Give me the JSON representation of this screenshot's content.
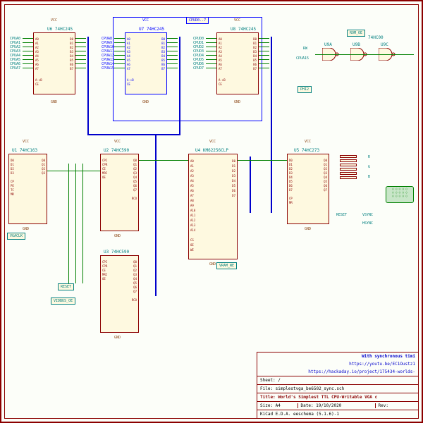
{
  "schematic": {
    "components": {
      "u6": {
        "ref": "U6",
        "part": "74HC245",
        "pins_left": [
          "A0",
          "A1",
          "A2",
          "A3",
          "A4",
          "A5",
          "A6",
          "A7"
        ],
        "pins_right": [
          "B0",
          "B1",
          "B2",
          "B3",
          "B4",
          "B5",
          "B6",
          "B7"
        ],
        "dir": "A->B",
        "ce": "CE",
        "power": "VCC",
        "gnd": "GND"
      },
      "u7": {
        "ref": "U7",
        "part": "74HC245",
        "pins_left": [
          "A0",
          "A1",
          "A2",
          "A3",
          "A4",
          "A5",
          "A6",
          "A7"
        ],
        "pins_right": [
          "B0",
          "B1",
          "B2",
          "B3",
          "B4",
          "B5",
          "B6",
          "B7"
        ],
        "dir": "A->B",
        "ce": "CE",
        "power": "VCC",
        "gnd": "GND"
      },
      "u8": {
        "ref": "U8",
        "part": "74HC245",
        "pins_left": [
          "A0",
          "A1",
          "A2",
          "A3",
          "A4",
          "A5",
          "A6",
          "A7"
        ],
        "pins_right": [
          "B0",
          "B1",
          "B2",
          "B3",
          "B4",
          "B5",
          "B6",
          "B7"
        ],
        "dir": "A->B",
        "ce": "CE",
        "power": "VCC",
        "gnd": "GND"
      },
      "u1": {
        "ref": "U1",
        "part": "74HC163",
        "pins": [
          "CP",
          "PE",
          "TC",
          "MR",
          "Q0",
          "Q1",
          "Q2",
          "Q3",
          "D0",
          "D1",
          "D2",
          "D3"
        ],
        "power": "VCC",
        "gnd": "GND"
      },
      "u2": {
        "ref": "U2",
        "part": "74HC590",
        "pins": [
          "CPC",
          "CPR",
          "CE",
          "MRC",
          "OE",
          "Q0",
          "Q1",
          "Q2",
          "Q3",
          "Q4",
          "Q5",
          "Q6",
          "Q7",
          "RCO"
        ],
        "power": "VCC",
        "gnd": "GND"
      },
      "u3": {
        "ref": "U3",
        "part": "74HC590",
        "pins": [
          "CPC",
          "CPR",
          "CE",
          "MRC",
          "OE",
          "Q0",
          "Q1",
          "Q2",
          "Q3",
          "Q4",
          "Q5",
          "Q6",
          "Q7",
          "RCO"
        ],
        "power": "VCC",
        "gnd": "GND"
      },
      "u4": {
        "ref": "U4",
        "part": "KM62256CLP",
        "pins_addr": [
          "A0",
          "A1",
          "A2",
          "A3",
          "A4",
          "A5",
          "A6",
          "A7",
          "A8",
          "A9",
          "A10",
          "A11",
          "A12",
          "A13",
          "A14"
        ],
        "pins_data": [
          "D0",
          "D1",
          "D2",
          "D3",
          "D4",
          "D5",
          "D6",
          "D7"
        ],
        "ctrl": [
          "CS",
          "OE",
          "WE"
        ],
        "power": "VCC",
        "gnd": "GND"
      },
      "u5": {
        "ref": "U5",
        "part": "74HC273",
        "pins": [
          "D0",
          "D1",
          "D2",
          "D3",
          "D4",
          "D5",
          "D6",
          "D7",
          "Q0",
          "Q1",
          "Q2",
          "Q3",
          "Q4",
          "Q5",
          "Q6",
          "Q7",
          "CP",
          "MR"
        ],
        "power": "VCC",
        "gnd": "GND"
      },
      "u9a": {
        "ref": "U9A",
        "part": "74HC00"
      },
      "u9b": {
        "ref": "U9B",
        "part": "74HC00"
      },
      "u9c": {
        "ref": "U9C",
        "part": "74HC00"
      }
    },
    "nets": {
      "cpud": "CPUD0..7",
      "cpua_left": [
        "CPUA0",
        "CPUA1",
        "CPUA2",
        "CPUA3",
        "CPUA4",
        "CPUA5",
        "CPUA6",
        "CPUA7"
      ],
      "cpua_mid": [
        "CPUA8",
        "CPUA9",
        "CPUA10",
        "CPUA11",
        "CPUA12",
        "CPUA13",
        "CPUA14",
        "CPUA15"
      ],
      "cpud_labels": [
        "CPUD0",
        "CPUD1",
        "CPUD2",
        "CPUD3",
        "CPUD4",
        "CPUD5",
        "CPUD6",
        "CPUD7"
      ],
      "addr_bus": [
        "A0",
        "A1",
        "A2",
        "A3",
        "A4",
        "A5",
        "A6",
        "A7",
        "A8",
        "A9",
        "A10",
        "A11",
        "A12",
        "A13",
        "A14"
      ],
      "data_bus": [
        "D0",
        "D1",
        "D2",
        "D3",
        "D4",
        "D5",
        "D6",
        "D7"
      ],
      "vgaclk": "VGACLK",
      "reset": "RESET",
      "vidbus_oe": "VIDBUS_OE",
      "vram_we": "VRAM_WE",
      "rom_oe": "ROM_OE",
      "rw": "RW",
      "cpua15": "CPUA15",
      "phi2": "PHI2",
      "vsync": "VSYNC",
      "hsync": "HSYNC",
      "rgb": [
        "R",
        "G",
        "B"
      ]
    },
    "power": {
      "vcc": "VCC",
      "gnd": "GND"
    }
  },
  "title_block": {
    "note": "With synchronous timi",
    "link1": "https://youtu.be/EC1Oustz1",
    "link2": "https://hackaday.io/project/175434-worlds-",
    "sheet": "Sheet: /",
    "file": "File: simplestvga_be6502_sync.sch",
    "title_label": "Title:",
    "title_text": "World's Simplest TTL CPU-Writable VGA c",
    "size": "Size: A4",
    "date": "Date: 19/10/2020",
    "rev": "Rev:",
    "tool": "KiCad E.D.A.  eeschema (5.1.6)-1"
  }
}
